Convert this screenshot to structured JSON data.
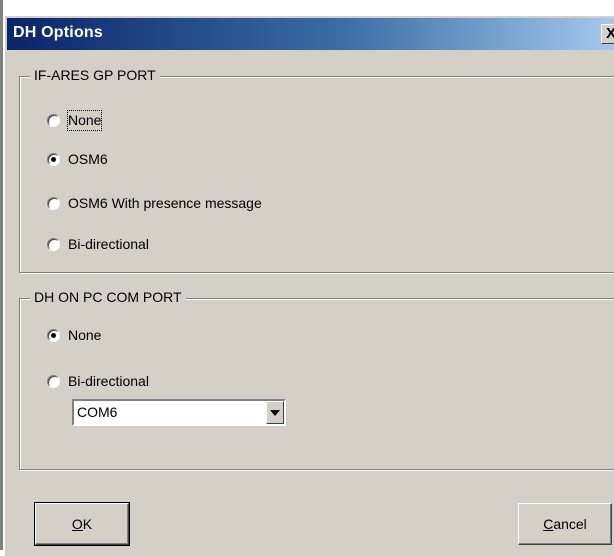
{
  "window": {
    "title": "DH Options",
    "close_glyph": "X"
  },
  "gp_port_group": {
    "caption": "IF-ARES GP PORT",
    "options": [
      {
        "label": "None",
        "checked": false,
        "focused": true
      },
      {
        "label": "OSM6",
        "checked": true,
        "focused": false
      },
      {
        "label": "OSM6 With presence message",
        "checked": false,
        "focused": false
      },
      {
        "label": "Bi-directional",
        "checked": false,
        "focused": false
      }
    ]
  },
  "pc_com_group": {
    "caption": "DH ON PC COM PORT",
    "options": [
      {
        "label": "None",
        "checked": true
      },
      {
        "label": "Bi-directional",
        "checked": false
      }
    ],
    "com_select": {
      "value": "COM6"
    }
  },
  "buttons": {
    "ok_mnemonic": "O",
    "ok_rest": "K",
    "cancel_mnemonic": "C",
    "cancel_rest": "ancel"
  },
  "colors": {
    "face": "#d4d0c8",
    "title_start": "#0a246a",
    "title_end": "#a6caf0"
  },
  "icons": {
    "close": "close-icon",
    "dropdown": "chevron-down-icon"
  }
}
